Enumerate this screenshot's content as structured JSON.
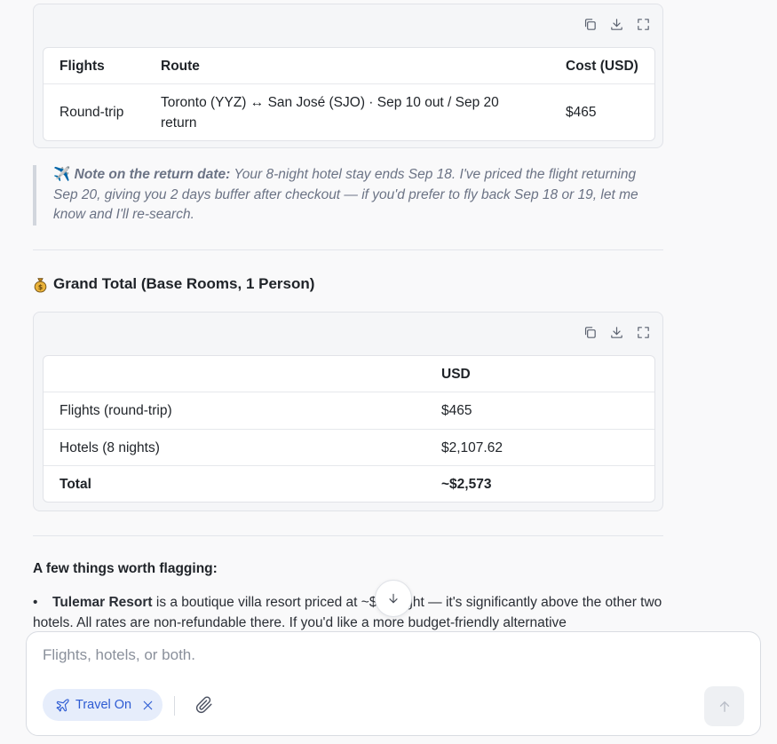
{
  "flights_table": {
    "headers": [
      "Flights",
      "Route",
      "Cost (USD)"
    ],
    "rows": [
      [
        "Round-trip",
        "Toronto (YYZ) ↔ San José (SJO) · Sep 10 out / Sep 20 return",
        "$465"
      ]
    ]
  },
  "note": {
    "emoji": "✈️",
    "label": "Note on the return date:",
    "text": " Your 8-night hotel stay ends Sep 18. I've priced the flight returning Sep 20, giving you 2 days buffer after checkout — if you'd prefer to fly back Sep 18 or 19, let me know and I'll re-search."
  },
  "grand_total": {
    "heading": "Grand Total (Base Rooms, 1 Person)",
    "headers": [
      "",
      "USD"
    ],
    "rows": [
      [
        "Flights (round-trip)",
        "$465"
      ],
      [
        "Hotels (8 nights)",
        "$2,107.62"
      ]
    ],
    "total_label": "Total",
    "total_value": "~$2,573"
  },
  "flagging": {
    "heading": "A few things worth flagging:",
    "bullet_bold": "Tulemar Resort",
    "bullet_text": " is a boutique villa resort priced at ~$…/night — it's significantly above the other two hotels. All rates are non-refundable there. If you'd like a more budget-friendly alternative"
  },
  "composer": {
    "placeholder": "Flights, hotels, or both.",
    "chip_label": "Travel On"
  }
}
